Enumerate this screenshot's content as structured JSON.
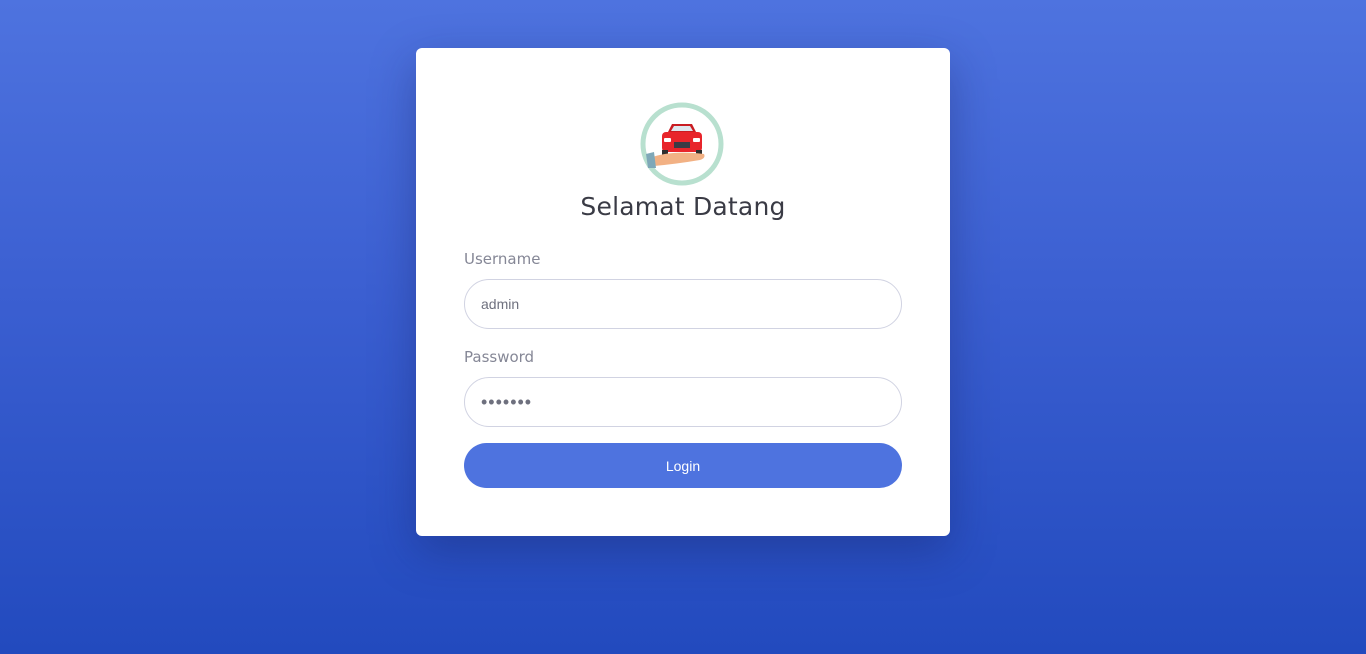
{
  "login": {
    "title": "Selamat Datang",
    "logo_icon": "car-in-hand-logo-icon",
    "username_label": "Username",
    "username_value": "admin",
    "password_label": "Password",
    "password_value": "•••••••",
    "login_button": "Login"
  },
  "colors": {
    "background_top": "#4e73df",
    "background_bottom": "#224abe",
    "button": "#4e73df",
    "logo_ring": "#b8e0cf",
    "car": "#e8252b"
  }
}
